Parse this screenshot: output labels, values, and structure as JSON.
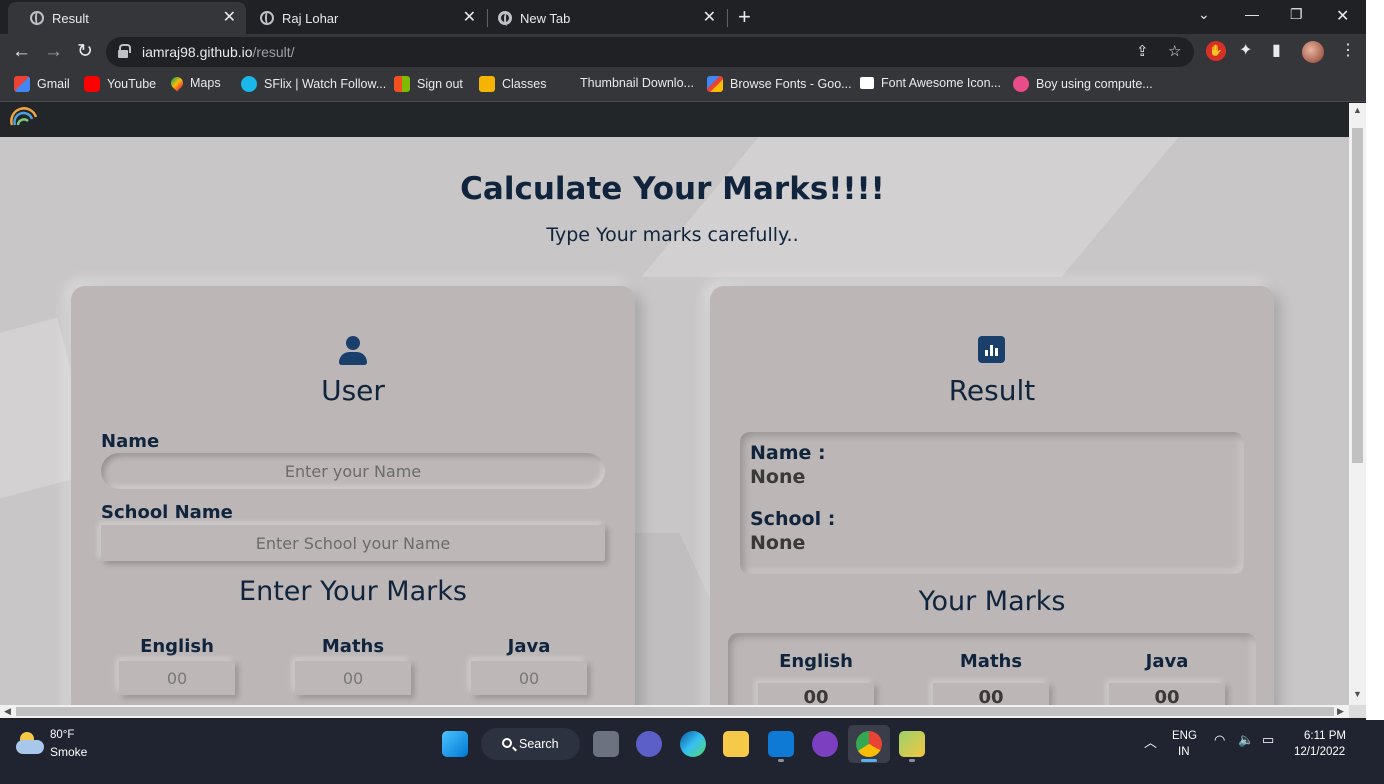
{
  "browser": {
    "tabs": [
      {
        "title": "Result",
        "active": true
      },
      {
        "title": "Raj Lohar",
        "active": false
      },
      {
        "title": "New Tab",
        "active": false
      }
    ],
    "address": {
      "host": "iamraj98.github.io",
      "path": "/result/"
    },
    "bookmarks": [
      {
        "label": "Gmail",
        "icon": "gmail-icon"
      },
      {
        "label": "YouTube",
        "icon": "youtube-icon"
      },
      {
        "label": "Maps",
        "icon": "maps-icon"
      },
      {
        "label": "SFlix | Watch Follow...",
        "icon": "sflix-icon"
      },
      {
        "label": "Sign out",
        "icon": "microsoft-icon"
      },
      {
        "label": "Classes",
        "icon": "classroom-icon"
      },
      {
        "label": "Thumbnail Downlo...",
        "icon": ""
      },
      {
        "label": "Browse Fonts - Goo...",
        "icon": "google-fonts-icon"
      },
      {
        "label": "Font Awesome Icon...",
        "icon": "font-awesome-icon"
      },
      {
        "label": "Boy using compute...",
        "icon": "dribbble-icon"
      }
    ]
  },
  "page": {
    "heading": "Calculate Your Marks!!!!",
    "subheading": "Type Your marks carefully..",
    "user_card": {
      "title": "User",
      "name_label": "Name",
      "name_placeholder": "Enter your Name",
      "school_label": "School Name",
      "school_placeholder": "Enter School your Name",
      "marks_title": "Enter Your Marks",
      "subjects": [
        {
          "label": "English",
          "placeholder": "00"
        },
        {
          "label": "Maths",
          "placeholder": "00"
        },
        {
          "label": "Java",
          "placeholder": "00"
        }
      ]
    },
    "result_card": {
      "title": "Result",
      "name_label": "Name :",
      "name_value": "None",
      "school_label": "School :",
      "school_value": "None",
      "marks_title": "Your Marks",
      "subjects": [
        {
          "label": "English",
          "value": "00"
        },
        {
          "label": "Maths",
          "value": "00"
        },
        {
          "label": "Java",
          "value": "00"
        }
      ]
    }
  },
  "taskbar": {
    "weather": {
      "temp": "80°F",
      "desc": "Smoke"
    },
    "search_label": "Search",
    "language": {
      "line1": "ENG",
      "line2": "IN"
    },
    "clock": {
      "time": "6:11 PM",
      "date": "12/1/2022"
    }
  },
  "colors": {
    "page_bg": "#c8c6c6",
    "card_bg": "#bcb6b6",
    "heading": "#10253d",
    "icon_accent": "#1a3f6b"
  }
}
